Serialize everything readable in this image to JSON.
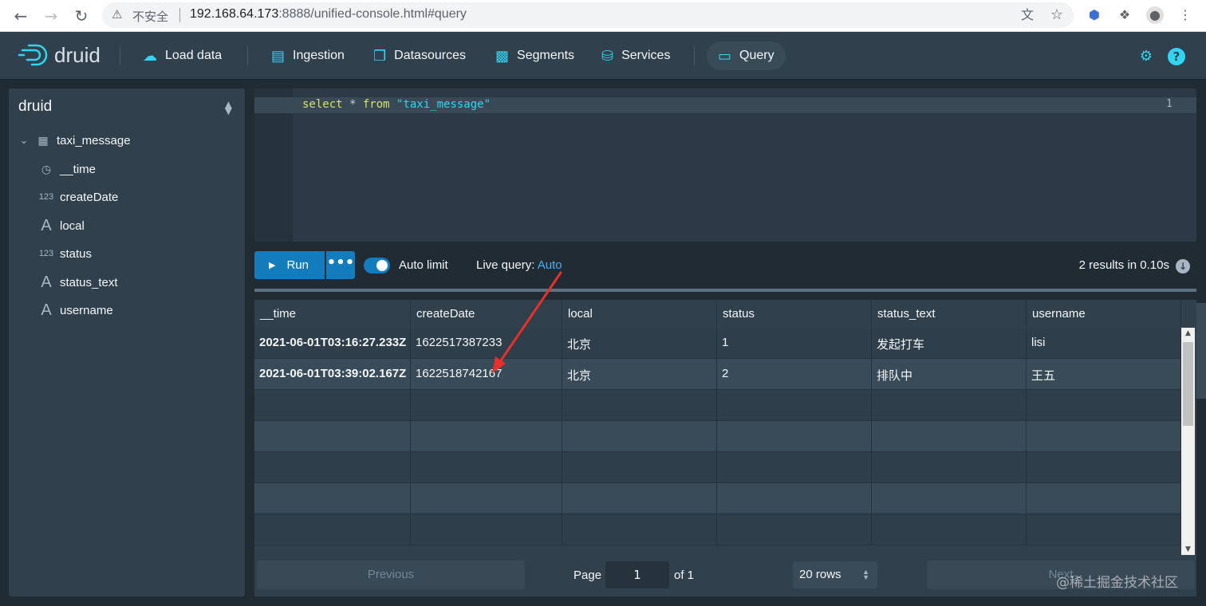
{
  "browser": {
    "insecure_label": "不安全",
    "url_host": "192.168.64.173",
    "url_rest": ":8888/unified-console.html#query"
  },
  "header": {
    "logo": "druid",
    "nav": [
      {
        "label": "Load data",
        "icon": "cloud-upload-icon"
      },
      {
        "label": "Ingestion",
        "icon": "gantt-chart-icon"
      },
      {
        "label": "Datasources",
        "icon": "multi-select-icon"
      },
      {
        "label": "Segments",
        "icon": "stacked-chart-icon"
      },
      {
        "label": "Services",
        "icon": "database-icon"
      },
      {
        "label": "Query",
        "icon": "application-icon",
        "active": true
      }
    ]
  },
  "sidebar": {
    "schema": "druid",
    "table": "taxi_message",
    "columns": [
      {
        "name": "__time",
        "type": "time"
      },
      {
        "name": "createDate",
        "type": "123"
      },
      {
        "name": "local",
        "type": "A"
      },
      {
        "name": "status",
        "type": "123"
      },
      {
        "name": "status_text",
        "type": "A"
      },
      {
        "name": "username",
        "type": "A"
      }
    ]
  },
  "editor": {
    "line_number": "1",
    "kw_select": "select",
    "star": " * ",
    "kw_from": "from",
    "table_literal": " \"taxi_message\""
  },
  "controls": {
    "run_label": "Run",
    "more_label": "•••",
    "auto_limit_label": "Auto limit",
    "live_query_label": "Live query: ",
    "live_query_value": "Auto",
    "results_info": "2 results in 0.10s"
  },
  "table": {
    "columns": [
      "__time",
      "createDate",
      "local",
      "status",
      "status_text",
      "username"
    ],
    "rows": [
      [
        "2021-06-01T03:16:27.233Z",
        "1622517387233",
        "北京",
        "1",
        "发起打车",
        "lisi"
      ],
      [
        "2021-06-01T03:39:02.167Z",
        "1622518742167",
        "北京",
        "2",
        "排队中",
        "王五"
      ]
    ]
  },
  "pagination": {
    "previous": "Previous",
    "page_label": "Page",
    "page_value": "1",
    "of_label": "of 1",
    "rows_select": "20 rows",
    "next": "Next"
  },
  "watermark": "@稀土掘金技术社区",
  "colors": {
    "accent": "#2fd5f2",
    "primary_button": "#137cbd",
    "annotation_arrow": "#e8302a"
  }
}
